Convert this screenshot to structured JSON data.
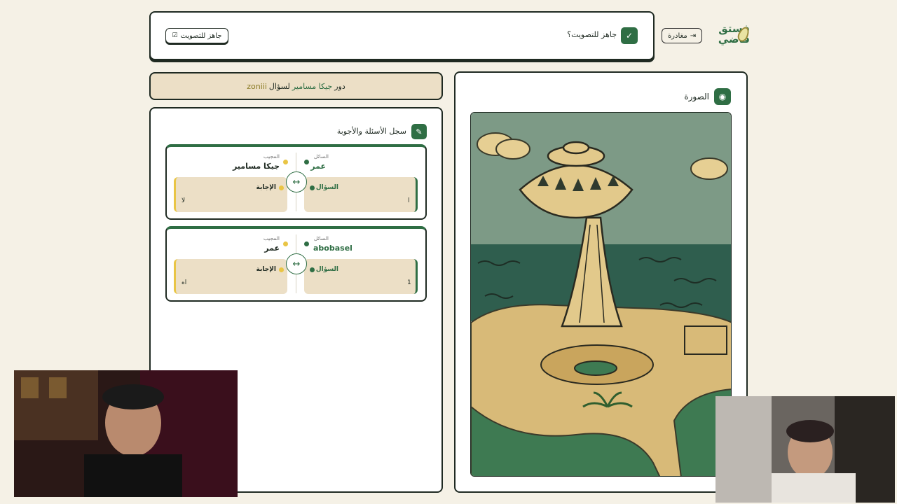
{
  "header": {
    "logo_line1": "فستق",
    "logo_line2": "فاضي",
    "leave_label": "مغادرة",
    "ready_question": "جاهز للتصويت؟",
    "ready_button": "جاهز للتصويت"
  },
  "turn": {
    "prefix": "دور",
    "player": "جيكا مسامير",
    "middle": "لسؤال",
    "target": "zoniii"
  },
  "log": {
    "title": "سجل الأسئلة والأجوبة",
    "entries": [
      {
        "asker_label": "السائل",
        "asker": "عمر",
        "answerer_label": "المجيب",
        "answerer": "جيكا مسامير",
        "question_label": "السؤال",
        "question": "ا",
        "answer_label": "الإجابة",
        "answer": "لا"
      },
      {
        "asker_label": "السائل",
        "asker": "abobasel",
        "answerer_label": "المجيب",
        "answerer": "عمر",
        "question_label": "السؤال",
        "question": "1",
        "answer_label": "الإجابة",
        "answer": "اه"
      }
    ]
  },
  "image_panel": {
    "title": "الصورة"
  },
  "colors": {
    "accent": "#2f6e44",
    "background": "#f5f1e6",
    "card_fill": "#ecdfc6",
    "answer_accent": "#e9c545"
  }
}
